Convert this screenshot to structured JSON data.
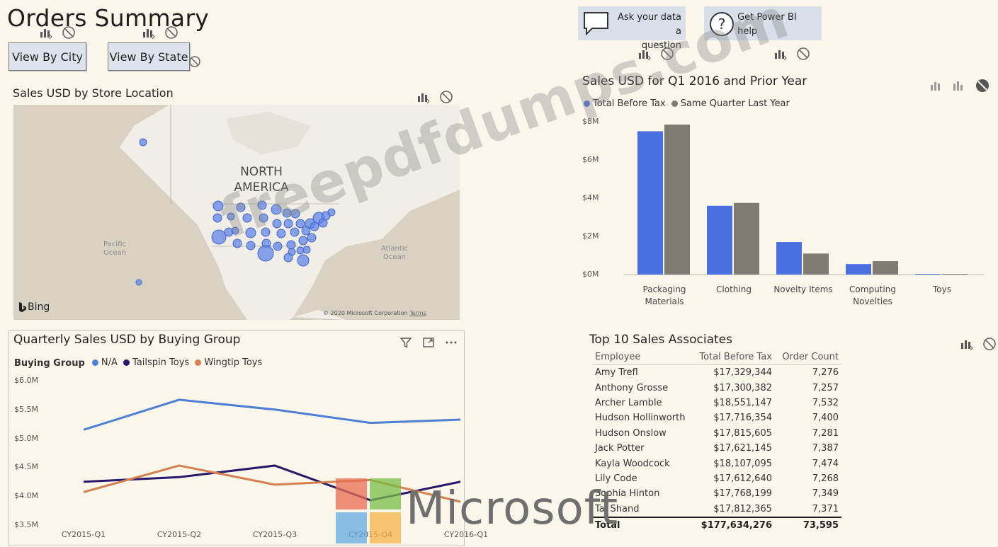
{
  "page": {
    "title": "Orders Summary"
  },
  "buttons": {
    "view_by_city": "View By City",
    "view_by_state": "View By State"
  },
  "top_actions": {
    "ask_line1": "Ask your data a",
    "ask_line2": "question",
    "help": "Get Power BI help"
  },
  "map": {
    "title": "Sales USD by Store Location",
    "continent_line1": "NORTH",
    "continent_line2": "AMERICA",
    "pacific_line1": "Pacific",
    "pacific_line2": "Ocean",
    "atlantic_line1": "Atlantic",
    "atlantic_line2": "Ocean",
    "bing": "Bing",
    "copyright": "© 2020 Microsoft Corporation",
    "terms": "Terms"
  },
  "bar_chart": {
    "title": "Sales USD for Q1 2016 and Prior Year",
    "y_ticks": [
      "$8M",
      "$6M",
      "$4M",
      "$2M",
      "$0M"
    ],
    "cat_labels": [
      [
        "Packaging",
        "Materials"
      ],
      [
        "Clothing",
        ""
      ],
      [
        "Novelty Items",
        ""
      ],
      [
        "Computing",
        "Novelties"
      ],
      [
        "Toys",
        ""
      ]
    ]
  },
  "line_chart": {
    "title": "Quarterly Sales USD by Buying Group",
    "legend_title": "Buying Group",
    "y_ticks": [
      "$6.0M",
      "$5.5M",
      "$5.0M",
      "$4.5M",
      "$4.0M",
      "$3.5M"
    ]
  },
  "chart_data": [
    {
      "type": "bar",
      "title": "Sales USD for Q1 2016 and Prior Year",
      "categories": [
        "Packaging Materials",
        "Clothing",
        "Novelty Items",
        "Computing Novelties",
        "Toys"
      ],
      "series": [
        {
          "name": "Total Before Tax",
          "color": "#4a6fe0",
          "values": [
            7.5,
            3.6,
            1.7,
            0.55,
            0.03
          ]
        },
        {
          "name": "Same Quarter Last Year",
          "color": "#7f7b73",
          "values": [
            7.85,
            3.75,
            1.1,
            0.7,
            0.02
          ]
        }
      ],
      "ylim": [
        0,
        8
      ],
      "legend": "top-left"
    },
    {
      "type": "line",
      "title": "Quarterly Sales USD by Buying Group",
      "categories": [
        "CY2015-Q1",
        "CY2015-Q2",
        "CY2015-Q3",
        "CY2015-Q4",
        "CY2016-Q1"
      ],
      "series": [
        {
          "name": "N/A",
          "color": "#4d7fd6",
          "values": [
            5.15,
            5.67,
            5.5,
            5.27,
            5.33
          ]
        },
        {
          "name": "Tailspin Toys",
          "color": "#26186b",
          "values": [
            4.25,
            4.33,
            4.53,
            3.93,
            4.27
          ]
        },
        {
          "name": "Wingtip Toys",
          "color": "#d6804f",
          "values": [
            4.07,
            4.53,
            4.2,
            4.28,
            3.88
          ]
        }
      ],
      "ylim": [
        3.5,
        6.0
      ],
      "legend": "top-left"
    }
  ],
  "associates": {
    "title": "Top 10 Sales Associates",
    "headers": [
      "Employee",
      "Total Before Tax",
      "Order Count"
    ],
    "rows": [
      [
        "Amy Trefl",
        "$17,329,344",
        "7,276"
      ],
      [
        "Anthony Grosse",
        "$17,300,382",
        "7,257"
      ],
      [
        "Archer Lamble",
        "$18,551,147",
        "7,532"
      ],
      [
        "Hudson Hollinworth",
        "$17,716,354",
        "7,400"
      ],
      [
        "Hudson Onslow",
        "$17,815,605",
        "7,281"
      ],
      [
        "Jack Potter",
        "$17,621,145",
        "7,387"
      ],
      [
        "Kayla Woodcock",
        "$18,107,095",
        "7,474"
      ],
      [
        "Lily Code",
        "$17,612,640",
        "7,268"
      ],
      [
        "Sophia Hinton",
        "$17,768,199",
        "7,349"
      ],
      [
        "Taj Shand",
        "$17,812,365",
        "7,371"
      ]
    ],
    "total": [
      "Total",
      "$177,634,276",
      "73,595"
    ]
  },
  "overlays": {
    "watermark": "freepdfdumps.com",
    "brand": "Microsoft"
  },
  "colors": {
    "background": "#fbf6ea",
    "button": "#dde3ec",
    "bar_blue": "#4a6fe0",
    "bar_gray": "#7f7b73"
  }
}
